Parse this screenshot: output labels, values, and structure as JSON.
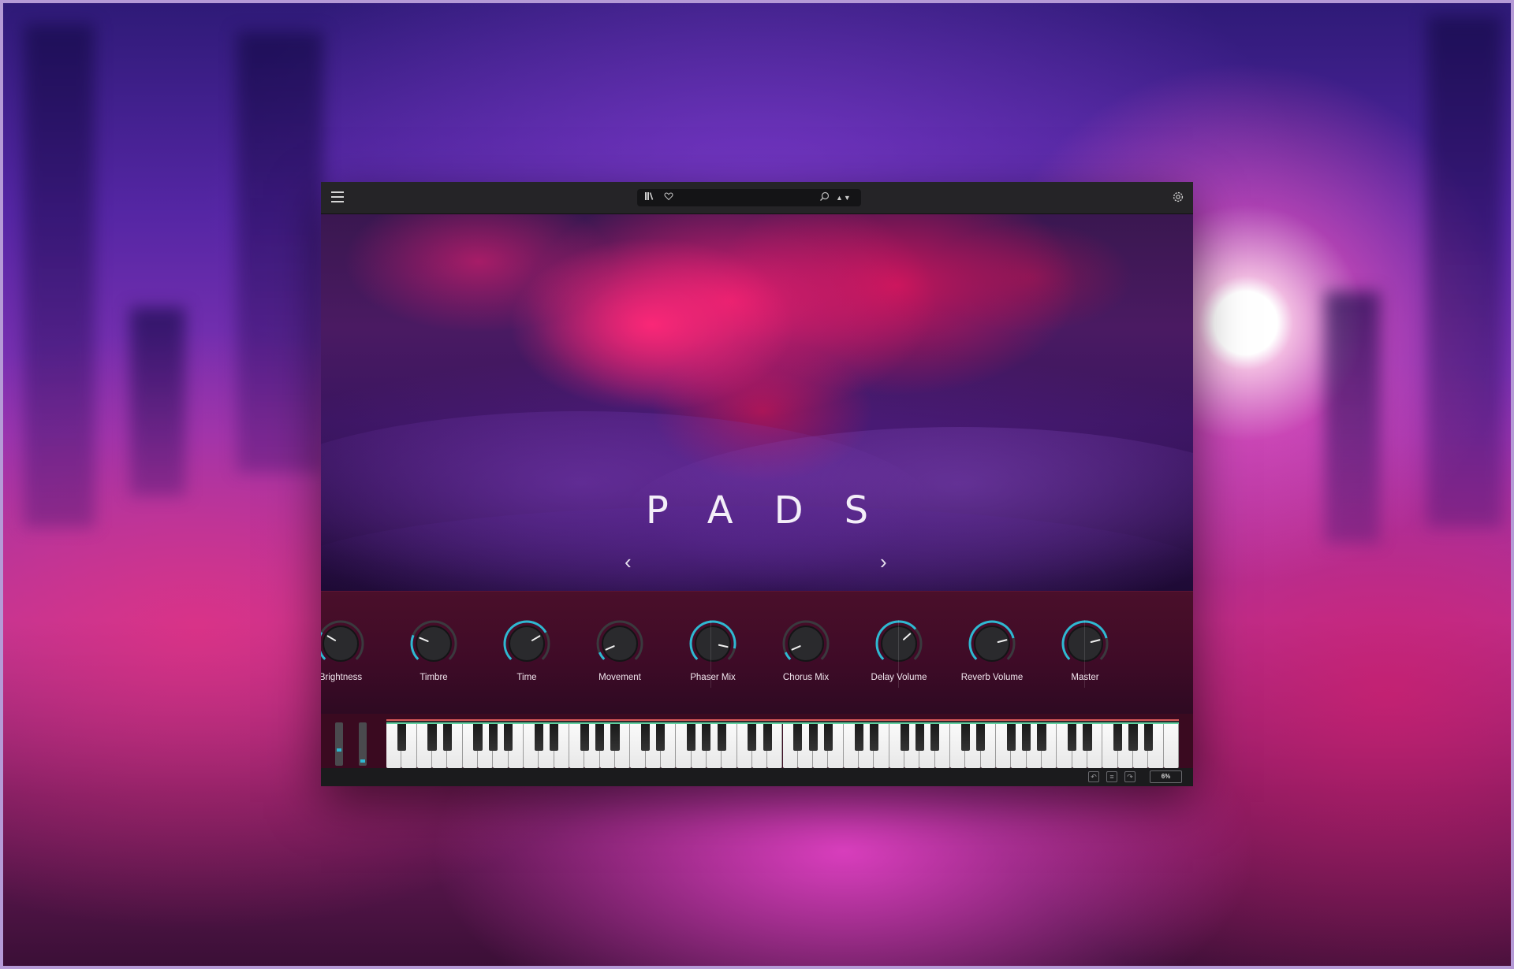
{
  "app": {
    "title": "PADS"
  },
  "header": {
    "menu_icon": "hamburger-icon",
    "library_icon": "library-icon",
    "favorite_icon": "heart-icon",
    "search_icon": "search-icon",
    "preset_nav_icon": "up-down-arrows-icon",
    "preset_nav_glyph": "▲▼",
    "settings_icon": "gear-icon"
  },
  "hero": {
    "title": "PADS",
    "prev_glyph": "‹",
    "next_glyph": "›"
  },
  "knobs": [
    {
      "label": "Brightness",
      "value": 0.28
    },
    {
      "label": "Timbre",
      "value": 0.25
    },
    {
      "label": "Time",
      "value": 0.72
    },
    {
      "label": "Movement",
      "value": 0.08
    },
    {
      "label": "Phaser Mix",
      "value": 0.88
    },
    {
      "label": "Chorus Mix",
      "value": 0.08
    },
    {
      "label": "Delay Volume",
      "value": 0.68
    },
    {
      "label": "Reverb Volume",
      "value": 0.78
    },
    {
      "label": "Master",
      "value": 0.78
    }
  ],
  "meters": [
    {
      "name": "left",
      "level": 0.35
    },
    {
      "name": "right",
      "level": 0.05
    }
  ],
  "keyboard": {
    "white_keys": 52,
    "first_note": "A"
  },
  "status": {
    "undo_icon": "undo-icon",
    "history_icon": "list-icon",
    "redo_icon": "redo-icon",
    "zoom": "6%"
  },
  "colors": {
    "accent": "#2fb8d2",
    "panel": "#3f0b27",
    "topbar": "#252427"
  }
}
